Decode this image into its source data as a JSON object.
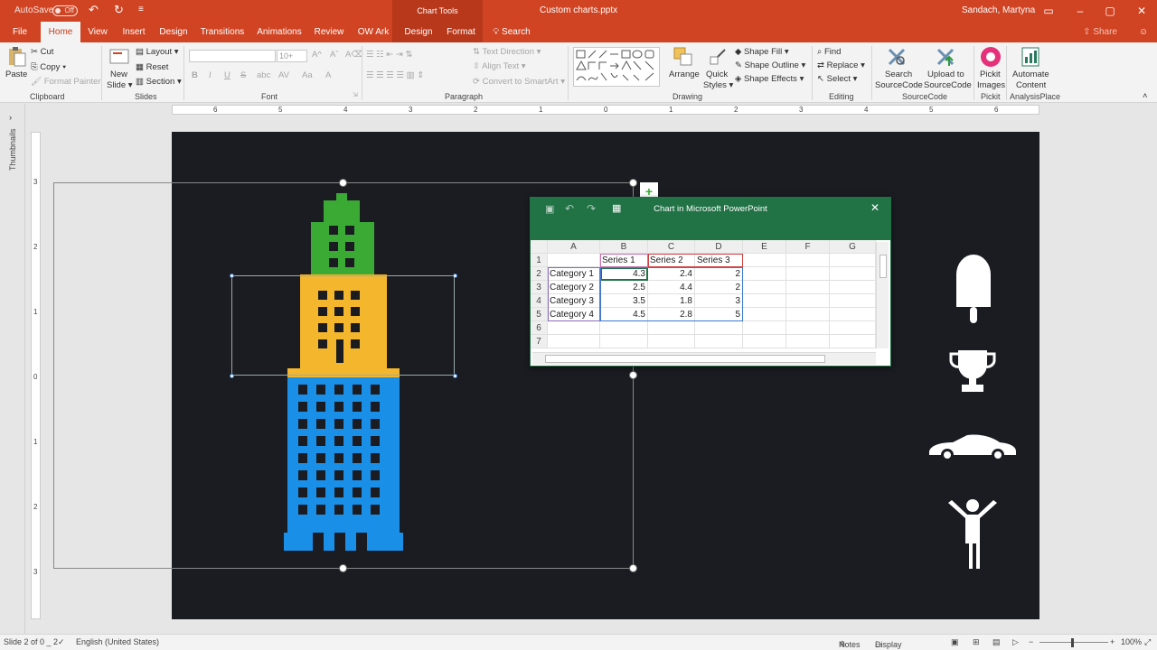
{
  "titlebar": {
    "autosave_label": "AutoSave",
    "autosave_state": "Off",
    "context_label": "Chart Tools",
    "filename": "Custom charts.pptx",
    "user": "Sandach, Martyna"
  },
  "tabs": [
    {
      "label": "File"
    },
    {
      "label": "Home"
    },
    {
      "label": "View"
    },
    {
      "label": "Insert"
    },
    {
      "label": "Design"
    },
    {
      "label": "Transitions"
    },
    {
      "label": "Animations"
    },
    {
      "label": "Review"
    },
    {
      "label": "OW Ark"
    },
    {
      "label": "Design"
    },
    {
      "label": "Format"
    }
  ],
  "search_label": "Search",
  "share_label": "Share",
  "ribbon": {
    "clipboard": {
      "paste": "Paste",
      "cut": "Cut",
      "copy": "Copy",
      "format_painter": "Format Painter",
      "label": "Clipboard"
    },
    "slides": {
      "new_slide_1": "New",
      "new_slide_2": "Slide",
      "layout": "Layout",
      "reset": "Reset",
      "section": "Section",
      "label": "Slides"
    },
    "font": {
      "size": "10+",
      "bold": "B",
      "italic": "I",
      "underline": "U",
      "strike": "S",
      "shadow": "abc",
      "spacing": "AV",
      "case": "Aa",
      "color": "A",
      "label": "Font"
    },
    "paragraph": {
      "text_direction": "Text Direction",
      "align_text": "Align Text",
      "smartart": "Convert to SmartArt",
      "label": "Paragraph"
    },
    "drawing": {
      "arrange": "Arrange",
      "quick_1": "Quick",
      "quick_2": "Styles",
      "fill": "Shape Fill",
      "outline": "Shape Outline",
      "effects": "Shape Effects",
      "label": "Drawing"
    },
    "editing": {
      "find": "Find",
      "replace": "Replace",
      "select": "Select",
      "label": "Editing"
    },
    "sourcecode": {
      "search_1": "Search",
      "search_2": "SourceCode",
      "upload_1": "Upload to",
      "upload_2": "SourceCode",
      "label": "SourceCode"
    },
    "pickit": {
      "btn_1": "Pickit",
      "btn_2": "Images",
      "label": "Pickit"
    },
    "analysisplace": {
      "btn_1": "Automate",
      "btn_2": "Content",
      "label": "AnalysisPlace"
    }
  },
  "thumbnails_label": "Thumbnails",
  "ruler_h": [
    "6",
    "5",
    "4",
    "3",
    "2",
    "1",
    "0",
    "1",
    "2",
    "3",
    "4",
    "5",
    "6"
  ],
  "ruler_v": [
    "3",
    "2",
    "1",
    "0",
    "1",
    "2",
    "3"
  ],
  "datawin": {
    "title": "Chart in Microsoft PowerPoint",
    "columns": [
      "A",
      "B",
      "C",
      "D",
      "E",
      "F",
      "G"
    ],
    "rows": [
      "1",
      "2",
      "3",
      "4",
      "5",
      "6",
      "7"
    ],
    "header": [
      "",
      "Series 1",
      "Series 2",
      "Series 3"
    ],
    "data": [
      {
        "cat": "Category 1",
        "s1": "4.3",
        "s2": "2.4",
        "s3": "2"
      },
      {
        "cat": "Category 2",
        "s1": "2.5",
        "s2": "4.4",
        "s3": "2"
      },
      {
        "cat": "Category 3",
        "s1": "3.5",
        "s2": "1.8",
        "s3": "3"
      },
      {
        "cat": "Category 4",
        "s1": "4.5",
        "s2": "2.8",
        "s3": "5"
      }
    ]
  },
  "colors": {
    "accent": "#d04423",
    "excel": "#217346",
    "building_top": "#3aaa35",
    "building_mid": "#f4b62c",
    "building_bottom": "#1a8fe8",
    "slide_bg": "#1a1c22"
  },
  "status": {
    "slide": "Slide 2 of 0 _ 2",
    "language": "English (United States)",
    "notes": "Notes",
    "display": "Display Settings",
    "zoom": "100%"
  }
}
